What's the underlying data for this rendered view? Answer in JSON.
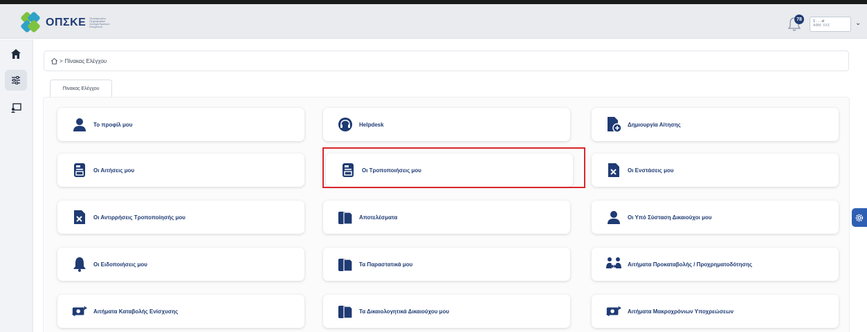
{
  "brand": {
    "name": "ΟΠΣΚΕ",
    "subtitle": "Ολοκληρωμένο Πληροφοριακό Σύστημα Κρατικών Ενισχύσεων",
    "colors": {
      "navy": "#1f3b73",
      "green": "#7fc241",
      "teal": "#2fa3c7"
    }
  },
  "header": {
    "notification_count": "78",
    "user_line1": "1 . . . el",
    "user_line2": "ΑΦΜ: ΧΧΧ"
  },
  "sidebar": {
    "items": [
      {
        "icon": "home-icon"
      },
      {
        "icon": "sliders-icon",
        "active": true
      },
      {
        "icon": "presentation-icon"
      }
    ]
  },
  "breadcrumb": {
    "separator": ">",
    "current": "Πίνακας Ελέγχου"
  },
  "tab": {
    "label": "Πίνακας Ελέγχου"
  },
  "cards": [
    {
      "label": "Το προφίλ μου",
      "icon": "person-icon"
    },
    {
      "label": "Helpdesk",
      "icon": "headset-icon"
    },
    {
      "label": "Δημιουργία Αίτησης",
      "icon": "file-plus-icon"
    },
    {
      "label": "Οι Αιτήσεις μου",
      "icon": "document-icon"
    },
    {
      "label": "Οι Τροποποιήσεις μου",
      "icon": "document-icon"
    },
    {
      "label": "Οι Ενστάσεις μου",
      "icon": "file-x-icon"
    },
    {
      "label": "Οι Αντιρρήσεις Τροποποίησής μου",
      "icon": "file-x-icon"
    },
    {
      "label": "Αποτελέσματα",
      "icon": "clipboard-icon"
    },
    {
      "label": "Οι Υπό Σύσταση Δικαιούχοι μου",
      "icon": "person-icon"
    },
    {
      "label": "Οι Ειδοποιήσεις μου",
      "icon": "bell-icon"
    },
    {
      "label": "Τα Παραστατικά μου",
      "icon": "clipboard-icon"
    },
    {
      "label": "Αιτήματα Προκαταβολής / Προχρηματοδότησης",
      "icon": "exchange-icon"
    },
    {
      "label": "Αιτήματα Καταβολής Ενίσχυσης",
      "icon": "money-transfer-icon"
    },
    {
      "label": "Τα Δικαιολογητικά Δικαιούχου μου",
      "icon": "clipboard-icon"
    },
    {
      "label": "Αιτήματα Μακροχρόνιων Υποχρεώσεων",
      "icon": "money-transfer-icon"
    }
  ],
  "settings_tab": {
    "icon": "gear-icon"
  }
}
